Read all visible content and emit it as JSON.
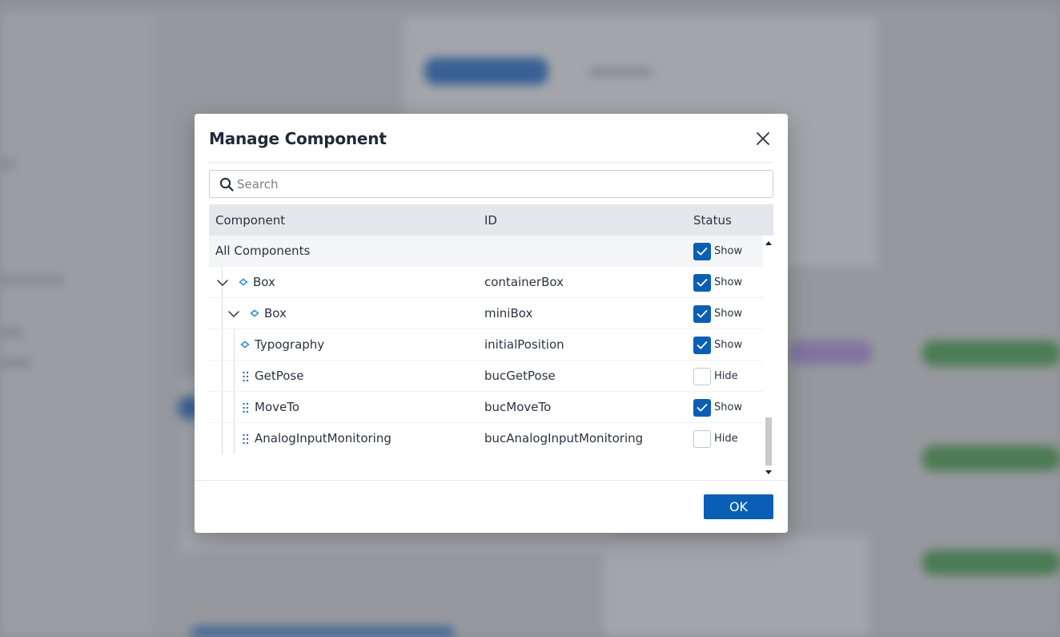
{
  "dialog": {
    "title": "Manage Component",
    "search_placeholder": "Search",
    "ok_label": "OK"
  },
  "table": {
    "headers": {
      "component": "Component",
      "id": "ID",
      "status": "Status"
    },
    "rows": [
      {
        "name": "All Components",
        "id": "",
        "status": "Show",
        "checked": true
      },
      {
        "name": "Box",
        "id": "containerBox",
        "status": "Show",
        "checked": true
      },
      {
        "name": "Box",
        "id": "miniBox",
        "status": "Show",
        "checked": true
      },
      {
        "name": "Typography",
        "id": "initialPosition",
        "status": "Show",
        "checked": true
      },
      {
        "name": "GetPose",
        "id": "bucGetPose",
        "status": "Hide",
        "checked": false
      },
      {
        "name": "MoveTo",
        "id": "bucMoveTo",
        "status": "Show",
        "checked": true
      },
      {
        "name": "AnalogInputMonitoring",
        "id": "bucAnalogInputMonitoring",
        "status": "Hide",
        "checked": false
      }
    ]
  },
  "icons": {
    "close": "close-icon",
    "search": "search-icon",
    "expand": "chevron-down-icon",
    "component": "diamond-icon",
    "drag": "drag-handle-icon",
    "check": "check-icon"
  },
  "colors": {
    "accent": "#0a5fb4",
    "tree_icon": "#2a8fd1",
    "header_bg": "#e5e7ec"
  }
}
